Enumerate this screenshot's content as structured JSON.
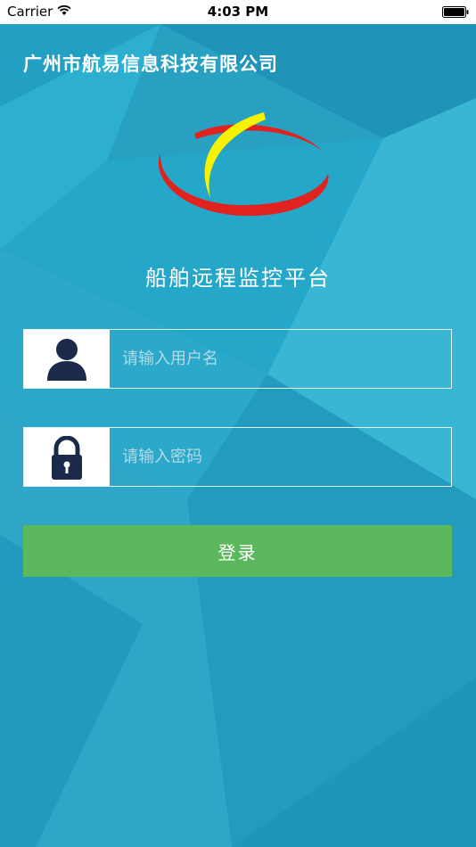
{
  "status_bar": {
    "carrier": "Carrier",
    "time": "4:03 PM"
  },
  "company_name": "广州市航易信息科技有限公司",
  "app_title": "船舶远程监控平台",
  "username": {
    "placeholder": "请输入用户名",
    "value": "",
    "icon": "user-icon"
  },
  "password": {
    "placeholder": "请输入密码",
    "value": "",
    "icon": "lock-icon"
  },
  "login_label": "登录",
  "colors": {
    "background": "#2aa3c4",
    "button": "#5cb85c",
    "icon": "#1b2a4a",
    "logo_red": "#e0231f",
    "logo_yellow": "#f7f200"
  }
}
